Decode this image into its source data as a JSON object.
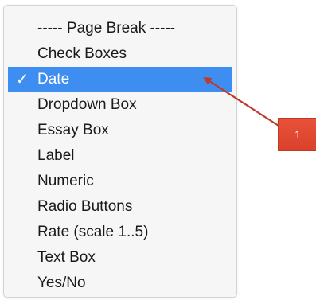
{
  "menu": {
    "items": [
      {
        "label": "----- Page Break -----",
        "selected": false
      },
      {
        "label": "Check Boxes",
        "selected": false
      },
      {
        "label": "Date",
        "selected": true
      },
      {
        "label": "Dropdown Box",
        "selected": false
      },
      {
        "label": "Essay Box",
        "selected": false
      },
      {
        "label": "Label",
        "selected": false
      },
      {
        "label": "Numeric",
        "selected": false
      },
      {
        "label": "Radio Buttons",
        "selected": false
      },
      {
        "label": "Rate (scale 1..5)",
        "selected": false
      },
      {
        "label": "Text Box",
        "selected": false
      },
      {
        "label": "Yes/No",
        "selected": false
      }
    ],
    "checkmark": "✓",
    "selection_color": "#3d8ef0"
  },
  "callout": {
    "label": "1",
    "color": "#d9412b",
    "icon": "arrow-icon"
  }
}
